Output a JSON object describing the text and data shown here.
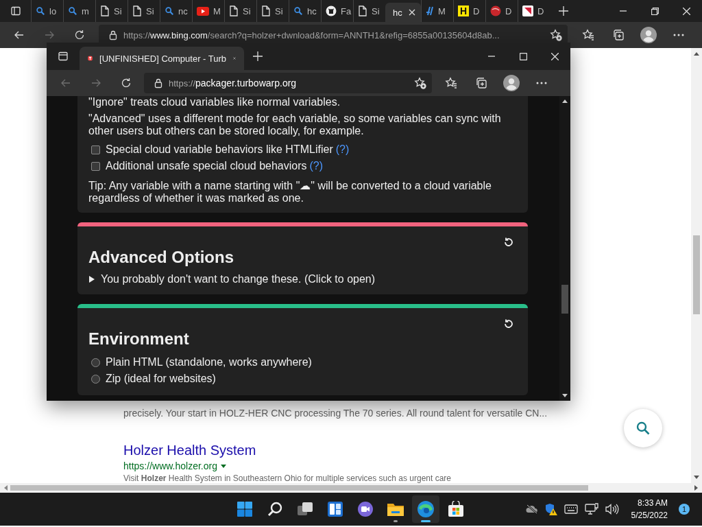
{
  "browser": {
    "tabs": [
      {
        "kind": "search",
        "label": "lo",
        "selected": false
      },
      {
        "kind": "search",
        "label": "m",
        "selected": false
      },
      {
        "kind": "page",
        "label": "Si",
        "selected": false
      },
      {
        "kind": "page",
        "label": "Si",
        "selected": false
      },
      {
        "kind": "search",
        "label": "nc",
        "selected": false
      },
      {
        "kind": "video",
        "label": "M",
        "selected": false
      },
      {
        "kind": "page",
        "label": "Si",
        "selected": false
      },
      {
        "kind": "page",
        "label": "Si",
        "selected": false
      },
      {
        "kind": "search",
        "label": "hc",
        "selected": false
      },
      {
        "kind": "github",
        "label": "Fa",
        "selected": false
      },
      {
        "kind": "page",
        "label": "Si",
        "selected": false
      },
      {
        "kind": "blank",
        "label": "hc",
        "selected": true
      },
      {
        "kind": "bars",
        "label": "M",
        "selected": false
      },
      {
        "kind": "letter",
        "glyph": "H",
        "label": "D",
        "selected": false
      },
      {
        "kind": "ball",
        "label": "D",
        "selected": false
      },
      {
        "kind": "flag",
        "label": "D",
        "selected": false
      }
    ],
    "address": "https://**www.bing.com**/search?q=holzer+dwnload&form=ANNTH1&refig=6855a00135604d8ab...",
    "forward_disabled": true
  },
  "page": {
    "snippet": "precisely. Your start in HOLZ-HER CNC processing The 70 series. All round talent for versatile CN...",
    "result_title": "Holzer Health System",
    "result_url": "https://www.holzer.org",
    "result_snippet": "Visit **Holzer** Health System in Southeastern Ohio for multiple services such as urgent care"
  },
  "popup": {
    "tab_title": "[UNFINISHED] Computer - Turb",
    "url_scheme": "https://",
    "url_host": "packager.turbowarp.org",
    "forward_disabled": true,
    "sections": [
      {
        "kind": "text",
        "paragraphs": [
          "\"Ignore\" treats cloud variables like normal variables.",
          "\"Advanced\" uses a different mode for each variable, so some variables can sync with other users but others can be stored locally, for example."
        ],
        "options": [
          {
            "label": "Special cloud variable behaviors like HTMLifier",
            "help": "(?)",
            "checked": false
          },
          {
            "label": "Additional unsafe special cloud behaviors",
            "help": "(?)",
            "checked": false
          }
        ],
        "tip": "Tip: Any variable with a name starting with \"☁\" will be converted to a cloud variable regardless of whether it was marked as one."
      },
      {
        "kind": "details",
        "color": "#f2637e",
        "title": "Advanced Options",
        "summary": "You probably don't want to change these. (Click to open)",
        "expanded": false
      },
      {
        "kind": "radios",
        "color": "#29be89",
        "title": "Environment",
        "options": [
          {
            "label": "Plain HTML (standalone, works anywhere)",
            "selected": false
          },
          {
            "label": "Zip (ideal for websites)",
            "selected": false
          }
        ]
      }
    ]
  },
  "taskbar": {
    "apps": [
      {
        "kind": "start",
        "active": false,
        "running": false
      },
      {
        "kind": "search",
        "active": false,
        "running": false
      },
      {
        "kind": "taskview",
        "active": false,
        "running": false
      },
      {
        "kind": "widgets",
        "active": false,
        "running": false
      },
      {
        "kind": "chat",
        "active": false,
        "running": false
      },
      {
        "kind": "explorer",
        "active": false,
        "running": true
      },
      {
        "kind": "edge",
        "active": true,
        "running": true
      },
      {
        "kind": "store",
        "active": false,
        "running": false
      }
    ],
    "time": "8:33 AM",
    "date": "5/25/2022",
    "notifications": "1"
  }
}
